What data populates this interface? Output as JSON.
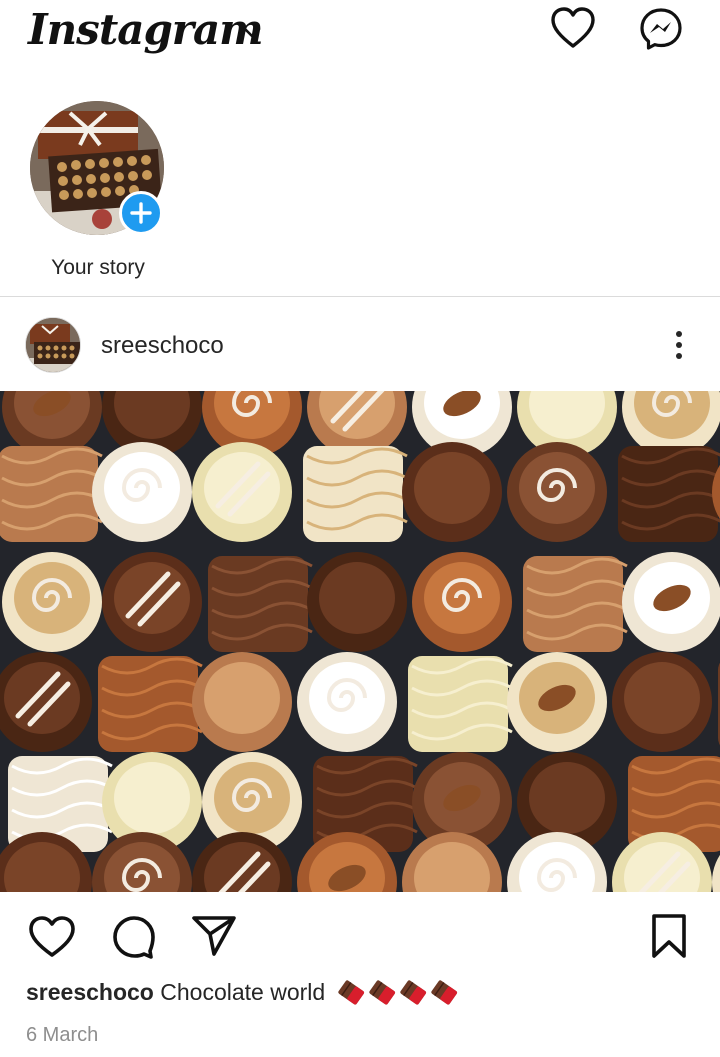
{
  "header": {
    "logo_text": "Instagram",
    "icons": [
      "chevron-down-icon",
      "heart-icon",
      "messenger-icon"
    ]
  },
  "stories": {
    "items": [
      {
        "label": "Your story",
        "badge_icon": "plus-icon"
      }
    ]
  },
  "post": {
    "username": "sreeschoco",
    "menu_icon": "more-vertical-icon",
    "image_alt": "Assorted chocolates",
    "actions": [
      "like-icon",
      "comment-icon",
      "share-icon",
      "save-icon"
    ],
    "caption_user": "sreeschoco",
    "caption_text": "Chocolate world",
    "caption_emoji": "chocolate-bar-emoji",
    "date": "6 March"
  },
  "colors": {
    "accent_blue": "#1f9bf0",
    "text": "#262626",
    "muted": "#8e8e8e",
    "divider": "#dbdbdb"
  }
}
